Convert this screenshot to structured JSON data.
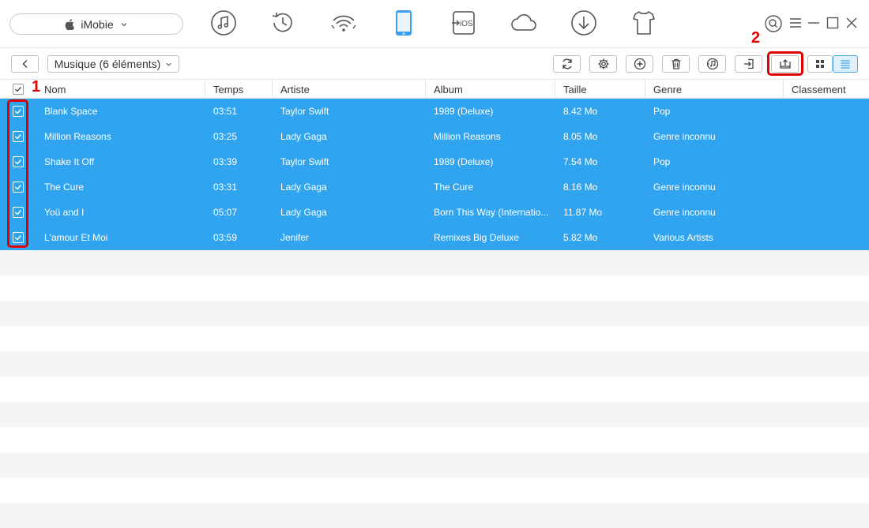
{
  "device": {
    "name": "iMobie"
  },
  "top_icons": [
    "music-icon",
    "history-icon",
    "wifi-sync-icon",
    "phone-icon",
    "ios-transfer-icon",
    "cloud-icon",
    "download-icon",
    "shirt-icon"
  ],
  "window_controls": [
    "account-icon",
    "menu-icon",
    "minimize-icon",
    "maximize-icon",
    "close-icon"
  ],
  "toolbar": {
    "category_label": "Musique (6 éléments)",
    "buttons": [
      "refresh-icon",
      "settings-icon",
      "add-icon",
      "delete-icon",
      "itunes-icon",
      "import-icon",
      "export-icon",
      "grid-view-icon",
      "list-view-icon"
    ]
  },
  "annotations": {
    "step1": "1",
    "step2": "2",
    "highlight_color": "#e00000"
  },
  "table": {
    "columns": [
      "Nom",
      "Temps",
      "Artiste",
      "Album",
      "Taille",
      "Genre",
      "Classement"
    ],
    "rows": [
      [
        "Blank Space",
        "03:51",
        "Taylor Swift",
        "1989 (Deluxe)",
        "8.42 Mo",
        "Pop",
        ""
      ],
      [
        "Million Reasons",
        "03:25",
        "Lady Gaga",
        "Million Reasons",
        "8.05 Mo",
        "Genre inconnu",
        ""
      ],
      [
        "Shake It Off",
        "03:39",
        "Taylor Swift",
        "1989 (Deluxe)",
        "7.54 Mo",
        "Pop",
        ""
      ],
      [
        "The Cure",
        "03:31",
        "Lady Gaga",
        "The Cure",
        "8.16 Mo",
        "Genre inconnu",
        ""
      ],
      [
        "Yoü and I",
        "05:07",
        "Lady Gaga",
        "Born This Way (Internatio...",
        "11.87 Mo",
        "Genre inconnu",
        ""
      ],
      [
        "L'amour Et Moi",
        "03:59",
        "Jenifer",
        "Remixes Big Deluxe",
        "5.82 Mo",
        "Various Artists",
        ""
      ]
    ]
  },
  "colors": {
    "selected_row": "#31a4ef",
    "active_icon": "#3a9ff0"
  }
}
